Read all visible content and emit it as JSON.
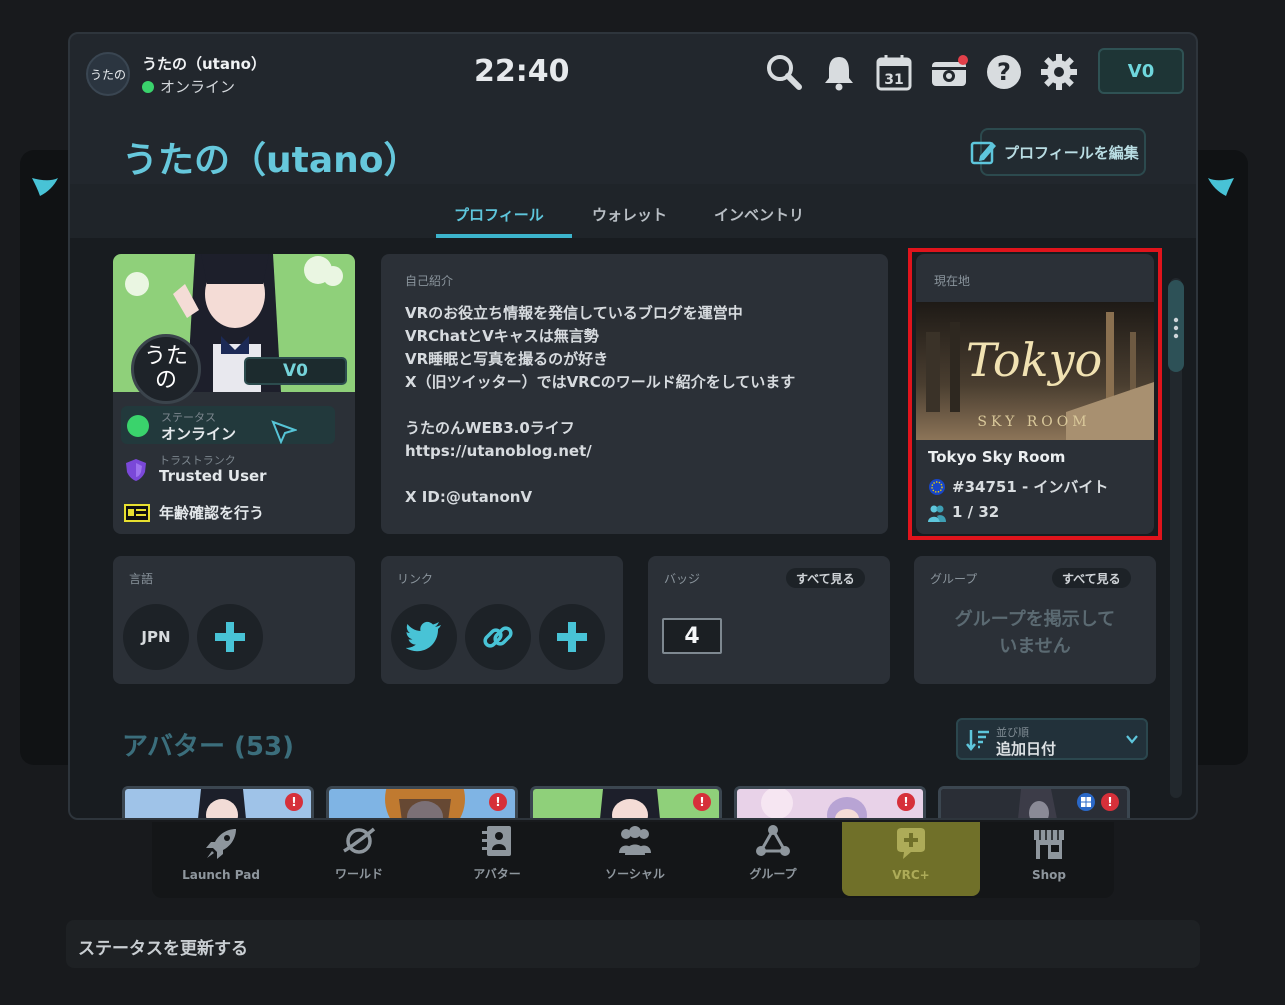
{
  "header": {
    "avatar_text": "うたの",
    "user_name": "うたの（utano）",
    "online_status": "オンライン",
    "clock": "22:40",
    "currency_label": "V0"
  },
  "profile": {
    "title": "うたの（utano）",
    "edit_button": "プロフィールを編集",
    "tabs": [
      {
        "label": "プロフィール",
        "active": true
      },
      {
        "label": "ウォレット",
        "active": false
      },
      {
        "label": "インベントリ",
        "active": false
      }
    ]
  },
  "profile_card": {
    "avatar_text_line1": "うた",
    "avatar_text_line2": "の",
    "currency_badge": "V0",
    "status_caption": "ステータス",
    "status_value": "オンライン",
    "trust_caption": "トラストランク",
    "trust_value": "Trusted User",
    "age_verify": "年齢確認を行う"
  },
  "bio": {
    "label": "自己紹介",
    "text": "VRのお役立ち情報を発信しているブログを運営中\nVRChatとVキャスは無言勢\nVR睡眠と写真を撮るのが好き\nX（旧ツイッター）ではVRCのワールド紹介をしています\n\nうたのんWEB3.0ライフ\nhttps://utanoblog.net/\n\nX ID:@utanonV"
  },
  "location": {
    "label": "現在地",
    "image_title": "Tokyo",
    "image_subtitle": "SKY ROOM",
    "world_name": "Tokyo Sky Room",
    "instance": "#34751 - インバイト",
    "occupancy": "1 / 32"
  },
  "languages": {
    "label": "言語",
    "items": [
      "JPN"
    ]
  },
  "links": {
    "label": "リンク"
  },
  "badges": {
    "label": "バッジ",
    "see_all": "すべて見る",
    "count": "4"
  },
  "groups": {
    "label": "グループ",
    "see_all": "すべて見る",
    "empty_line1": "グループを掲示して",
    "empty_line2": "いません"
  },
  "avatars": {
    "title": "アバター (53)",
    "sort_caption": "並び順",
    "sort_value": "追加日付",
    "warn_symbol": "!"
  },
  "dock": {
    "items": [
      {
        "label": "Launch Pad",
        "icon": "rocket-icon"
      },
      {
        "label": "ワールド",
        "icon": "planet-icon"
      },
      {
        "label": "アバター",
        "icon": "avatar-icon"
      },
      {
        "label": "ソーシャル",
        "icon": "people-icon"
      },
      {
        "label": "グループ",
        "icon": "group-icon"
      },
      {
        "label": "VRC+",
        "icon": "vrcplus-icon"
      },
      {
        "label": "Shop",
        "icon": "shop-icon"
      }
    ]
  },
  "status_bar": {
    "label": "ステータスを更新する"
  },
  "colors": {
    "accent": "#5ec6dc",
    "highlight_frame": "#e0141c",
    "online": "#3ad36c"
  }
}
